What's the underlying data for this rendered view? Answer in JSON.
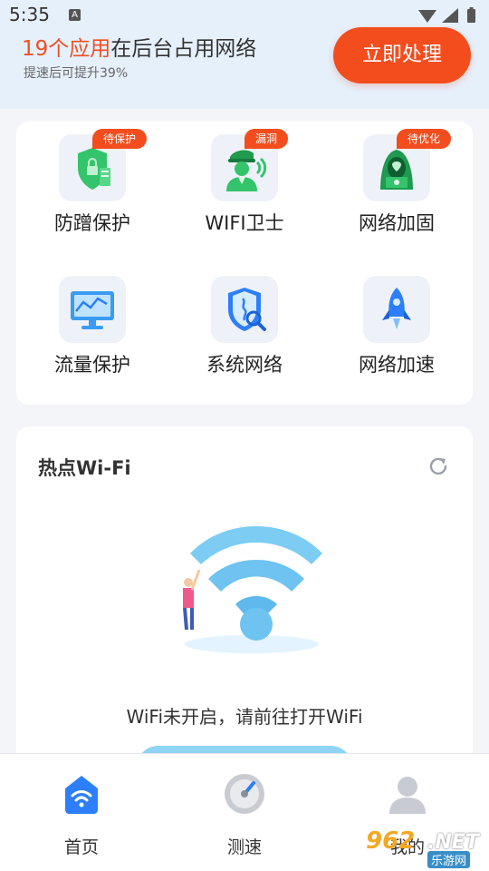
{
  "status_bar": {
    "time": "5:35",
    "notif_letter": "A"
  },
  "header": {
    "count_text": "19个应用",
    "rest_text": "在后台占用网络",
    "sub_text": "提速后可提升39%",
    "action_label": "立即处理"
  },
  "features": [
    {
      "label": "防蹭保护",
      "badge": "待保护",
      "icon": "shield-lock-icon"
    },
    {
      "label": "WIFI卫士",
      "badge": "漏洞",
      "icon": "guard-icon"
    },
    {
      "label": "网络加固",
      "badge": "待优化",
      "icon": "hacker-icon"
    },
    {
      "label": "流量保护",
      "badge": "",
      "icon": "monitor-chart-icon"
    },
    {
      "label": "系统网络",
      "badge": "",
      "icon": "shield-scan-icon"
    },
    {
      "label": "网络加速",
      "badge": "",
      "icon": "rocket-icon"
    }
  ],
  "wifi_card": {
    "title": "热点Wi-Fi",
    "message": "WiFi未开启，请前往打开WiFi"
  },
  "tabs": [
    {
      "label": "首页",
      "icon": "home-wifi-icon",
      "active": true
    },
    {
      "label": "测速",
      "icon": "speedometer-icon",
      "active": false
    },
    {
      "label": "我的",
      "icon": "user-icon",
      "active": false
    }
  ],
  "watermark": {
    "number": "962",
    "suffix": ".NET",
    "sub": "乐游网"
  },
  "colors": {
    "accent": "#f34d1e",
    "primary_blue": "#2d7ff9",
    "page_bg": "#f3f5f9",
    "header_bg": "#e6f0fb"
  }
}
